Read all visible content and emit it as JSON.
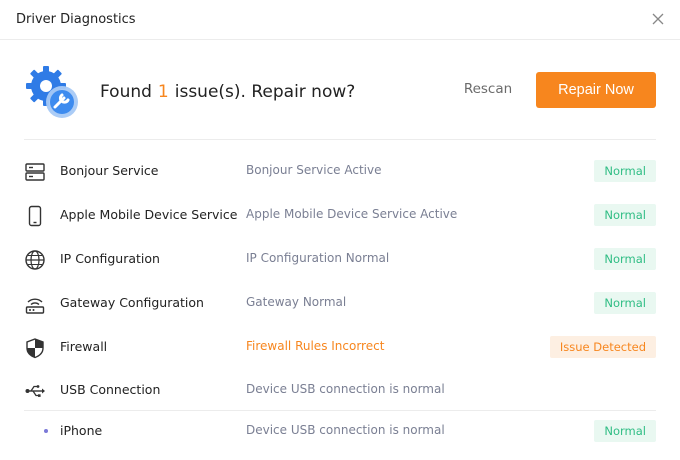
{
  "window": {
    "title": "Driver Diagnostics"
  },
  "header": {
    "headline_prefix": "Found",
    "issue_count": "1",
    "headline_suffix": "issue(s). Repair now?",
    "rescan_label": "Rescan",
    "repair_label": "Repair Now"
  },
  "colors": {
    "accent": "#f7861e",
    "ok_text": "#2fbd84",
    "ok_bg": "#e9f8f1",
    "bad_bg": "#fdefe2",
    "desc": "#7a7f93"
  },
  "items": [
    {
      "icon": "server-icon",
      "name": "Bonjour Service",
      "desc": "Bonjour Service Active",
      "status": "Normal",
      "state": "ok"
    },
    {
      "icon": "mobile-phone-icon",
      "name": "Apple Mobile Device Service",
      "desc": "Apple Mobile Device Service Active",
      "status": "Normal",
      "state": "ok"
    },
    {
      "icon": "globe-icon",
      "name": "IP Configuration",
      "desc": "IP Configuration Normal",
      "status": "Normal",
      "state": "ok"
    },
    {
      "icon": "router-icon",
      "name": "Gateway Configuration",
      "desc": "Gateway Normal",
      "status": "Normal",
      "state": "ok"
    },
    {
      "icon": "shield-icon",
      "name": "Firewall",
      "desc": "Firewall Rules Incorrect",
      "status": "Issue Detected",
      "state": "bad"
    },
    {
      "icon": "usb-icon",
      "name": "USB Connection",
      "desc": "Device USB connection is normal",
      "status": "",
      "state": "none"
    },
    {
      "icon": "bullet-icon",
      "name": "iPhone",
      "desc": "Device USB connection is normal",
      "status": "Normal",
      "state": "ok"
    }
  ]
}
